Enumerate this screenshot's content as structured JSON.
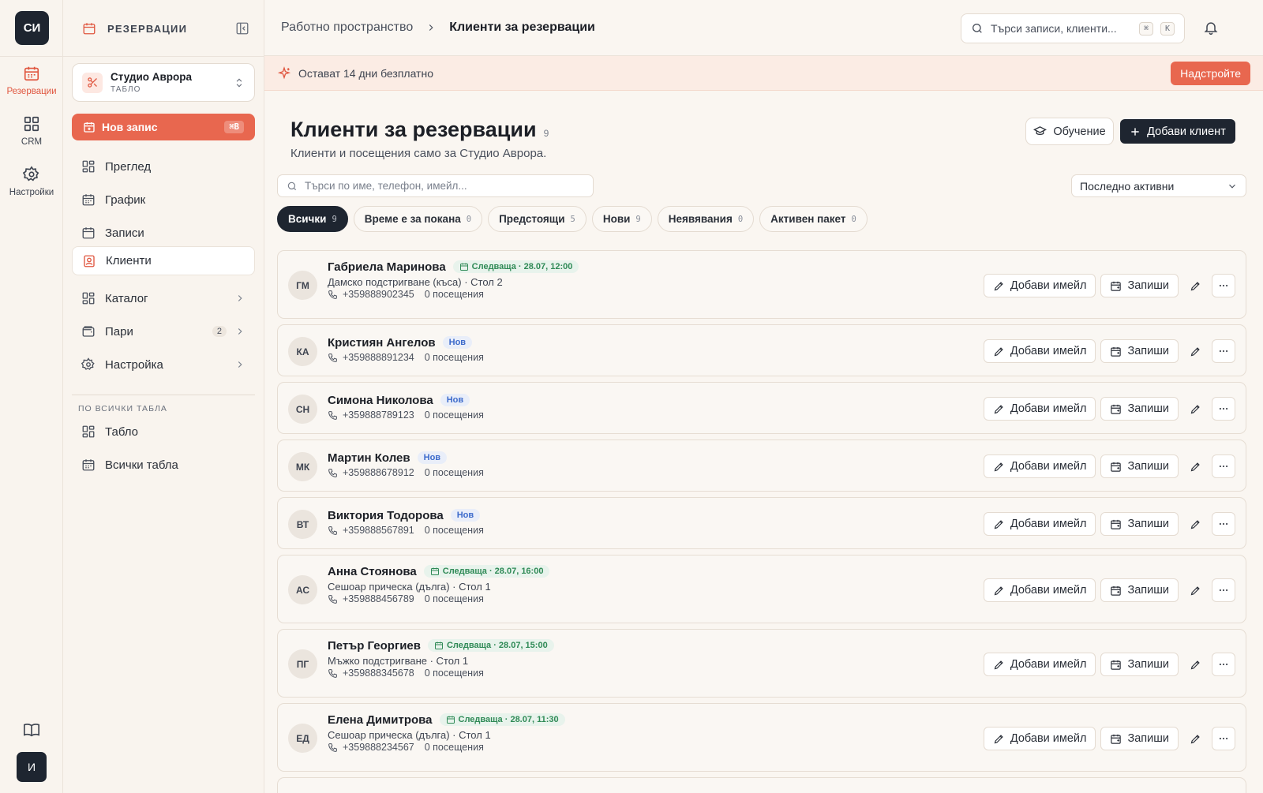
{
  "rail": {
    "logo": "СИ",
    "items": [
      {
        "label": "Резервации",
        "icon": "calendar-icon"
      },
      {
        "label": "CRM",
        "icon": "grid-icon"
      },
      {
        "label": "Настройки",
        "icon": "gear-icon"
      }
    ],
    "user_initial": "И"
  },
  "sidebar": {
    "title": "РЕЗЕРВАЦИИ",
    "studio": {
      "name": "Студио Аврора",
      "sub": "ТАБЛО"
    },
    "new_button": {
      "label": "Нов запис",
      "shortcut": "⌘B"
    },
    "nav": [
      {
        "label": "Преглед",
        "icon": "dashboard-icon"
      },
      {
        "label": "График",
        "icon": "calendar-icon"
      },
      {
        "label": "Записи",
        "icon": "calendar-check-icon"
      },
      {
        "label": "Клиенти",
        "icon": "contact-icon",
        "active": true
      },
      {
        "label": "Каталог",
        "icon": "dashboard-icon",
        "has_chevron": true
      },
      {
        "label": "Пари",
        "icon": "wallet-icon",
        "badge": "2",
        "has_chevron": true
      },
      {
        "label": "Настройка",
        "icon": "gear-icon",
        "has_chevron": true
      }
    ],
    "section_label": "ПО ВСИЧКИ ТАБЛА",
    "section_items": [
      {
        "label": "Табло",
        "icon": "dashboard-icon"
      },
      {
        "label": "Всички табла",
        "icon": "calendar-icon"
      }
    ]
  },
  "topbar": {
    "breadcrumb": [
      "Работно пространство",
      "Клиенти за резервации"
    ],
    "search_placeholder": "Търси записи, клиенти...",
    "kbd": [
      "⌘",
      "K"
    ]
  },
  "trial": {
    "text": "Остават 14 дни безплатно",
    "upgrade_label": "Надстройте"
  },
  "page": {
    "title": "Клиенти за резервации",
    "count": "9",
    "subtitle": "Клиенти и посещения само за Студио Аврора.",
    "learn_label": "Обучение",
    "add_label": "Добави клиент",
    "search_placeholder": "Търси по име, телефон, имейл...",
    "sort_value": "Последно активни"
  },
  "filters": [
    {
      "label": "Всички",
      "count": "9",
      "active": true
    },
    {
      "label": "Време е за покана",
      "count": "0"
    },
    {
      "label": "Предстоящи",
      "count": "5"
    },
    {
      "label": "Нови",
      "count": "9"
    },
    {
      "label": "Неявявания",
      "count": "0"
    },
    {
      "label": "Активен пакет",
      "count": "0"
    }
  ],
  "row_actions": {
    "email": "Добави имейл",
    "book": "Запиши"
  },
  "clients": [
    {
      "initials": "ГМ",
      "name": "Габриела Маринова",
      "tag_type": "next",
      "tag": "Следваща · 28.07, 12:00",
      "service": "Дамско подстригване (къса) · Стол 2",
      "phone": "+359888902345",
      "visits": "0 посещения"
    },
    {
      "initials": "КА",
      "name": "Кристиян Ангелов",
      "tag_type": "new",
      "tag": "Нов",
      "service": "",
      "phone": "+359888891234",
      "visits": "0 посещения"
    },
    {
      "initials": "СН",
      "name": "Симона Николова",
      "tag_type": "new",
      "tag": "Нов",
      "service": "",
      "phone": "+359888789123",
      "visits": "0 посещения"
    },
    {
      "initials": "МК",
      "name": "Мартин Колев",
      "tag_type": "new",
      "tag": "Нов",
      "service": "",
      "phone": "+359888678912",
      "visits": "0 посещения"
    },
    {
      "initials": "ВТ",
      "name": "Виктория Тодорова",
      "tag_type": "new",
      "tag": "Нов",
      "service": "",
      "phone": "+359888567891",
      "visits": "0 посещения"
    },
    {
      "initials": "АС",
      "name": "Анна Стоянова",
      "tag_type": "next",
      "tag": "Следваща · 28.07, 16:00",
      "service": "Сешоар прическа (дълга) · Стол 1",
      "phone": "+359888456789",
      "visits": "0 посещения"
    },
    {
      "initials": "ПГ",
      "name": "Петър Георгиев",
      "tag_type": "next",
      "tag": "Следваща · 28.07, 15:00",
      "service": "Мъжко подстригване · Стол 1",
      "phone": "+359888345678",
      "visits": "0 посещения"
    },
    {
      "initials": "ЕД",
      "name": "Елена Димитрова",
      "tag_type": "next",
      "tag": "Следваща · 28.07, 11:30",
      "service": "Сешоар прическа (дълга) · Стол 1",
      "phone": "+359888234567",
      "visits": "0 посещения"
    }
  ]
}
